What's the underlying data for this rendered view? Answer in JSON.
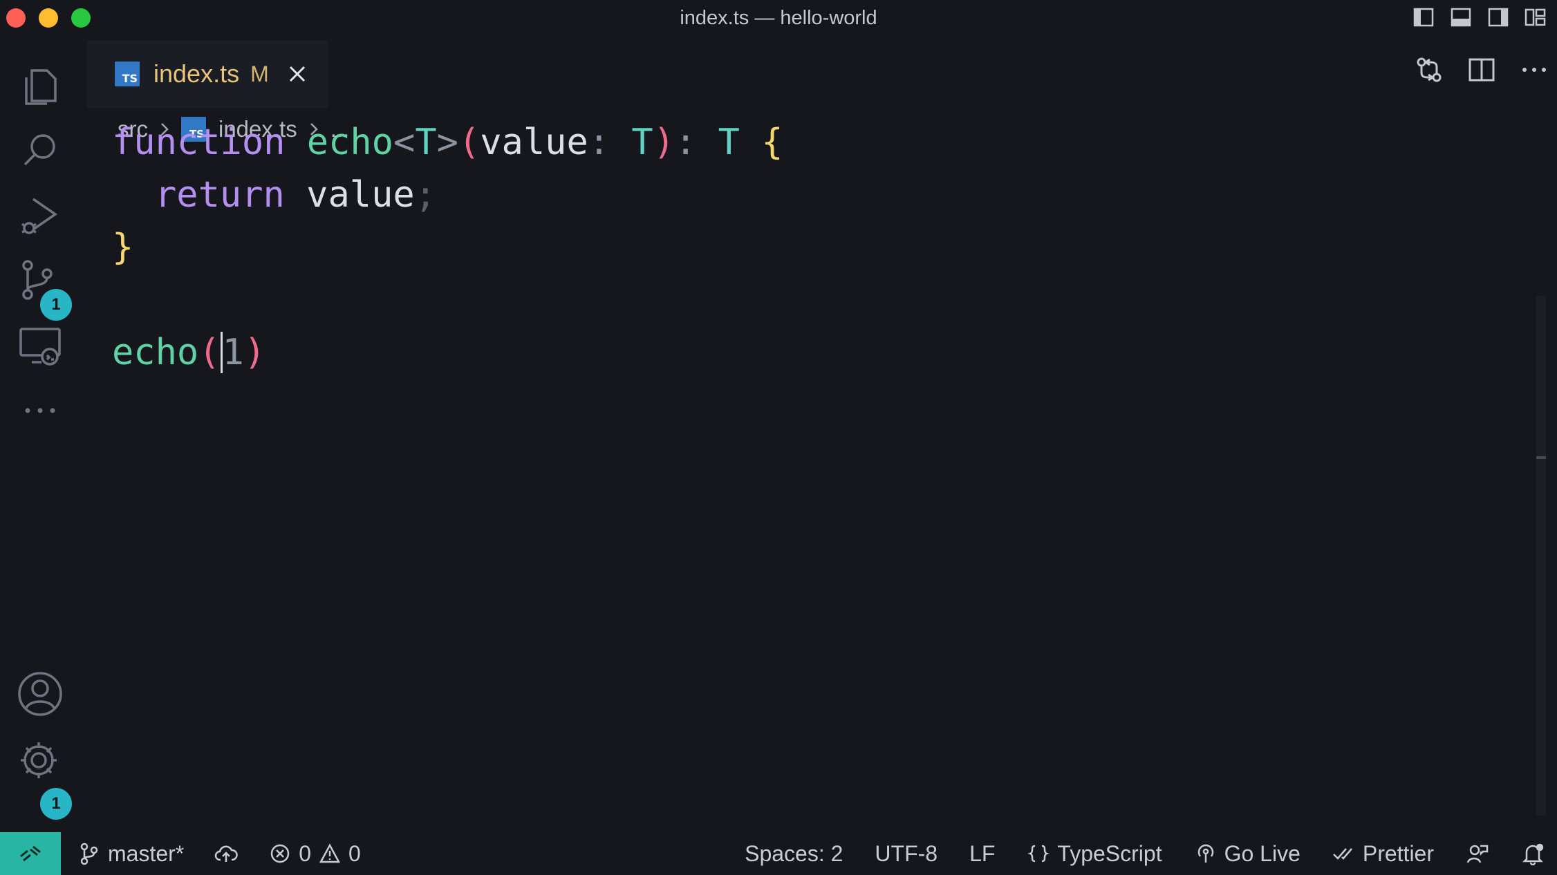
{
  "window": {
    "title": "index.ts — hello-world"
  },
  "activity_bar": {
    "items": [
      {
        "name": "explorer",
        "icon": "files-icon"
      },
      {
        "name": "search",
        "icon": "search-icon"
      },
      {
        "name": "run-and-debug",
        "icon": "run-debug-icon"
      },
      {
        "name": "source-control",
        "icon": "source-control-icon",
        "badge": "1"
      },
      {
        "name": "remote-explorer",
        "icon": "remote-explorer-icon"
      },
      {
        "name": "more",
        "icon": "more-icon"
      }
    ],
    "bottom": [
      {
        "name": "accounts",
        "icon": "account-icon"
      },
      {
        "name": "manage",
        "icon": "gear-icon",
        "badge": "1"
      }
    ]
  },
  "tab": {
    "file_icon_text": "TS",
    "title": "index.ts",
    "status": "M"
  },
  "breadcrumb": {
    "folder": "src",
    "file": "index.ts",
    "symbol": "..."
  },
  "code": {
    "line1": {
      "kw": "function",
      "fn": "echo",
      "lt": "<",
      "tparam": "T",
      "gt": ">",
      "open": "(",
      "param": "value",
      "colon": ":",
      "ptype": "T",
      "close": ")",
      "colon2": ":",
      "rtype": "T",
      "brace": "{"
    },
    "line2": {
      "kw": "return",
      "ident": "value",
      "semi": ";"
    },
    "line3": {
      "brace": "}"
    },
    "line5": {
      "fn": "echo",
      "open": "(",
      "arg": "1",
      "close": ")"
    }
  },
  "statusbar": {
    "branch": "master*",
    "errors": "0",
    "warnings": "0",
    "spaces": "Spaces: 2",
    "encoding": "UTF-8",
    "eol": "LF",
    "language": "TypeScript",
    "go_live": "Go Live",
    "prettier": "Prettier"
  },
  "colors": {
    "background": "#15171c",
    "accent": "#28b5c6",
    "keyword": "#b48ef0",
    "function": "#5fd3a5",
    "tab_title": "#e8c37c"
  }
}
